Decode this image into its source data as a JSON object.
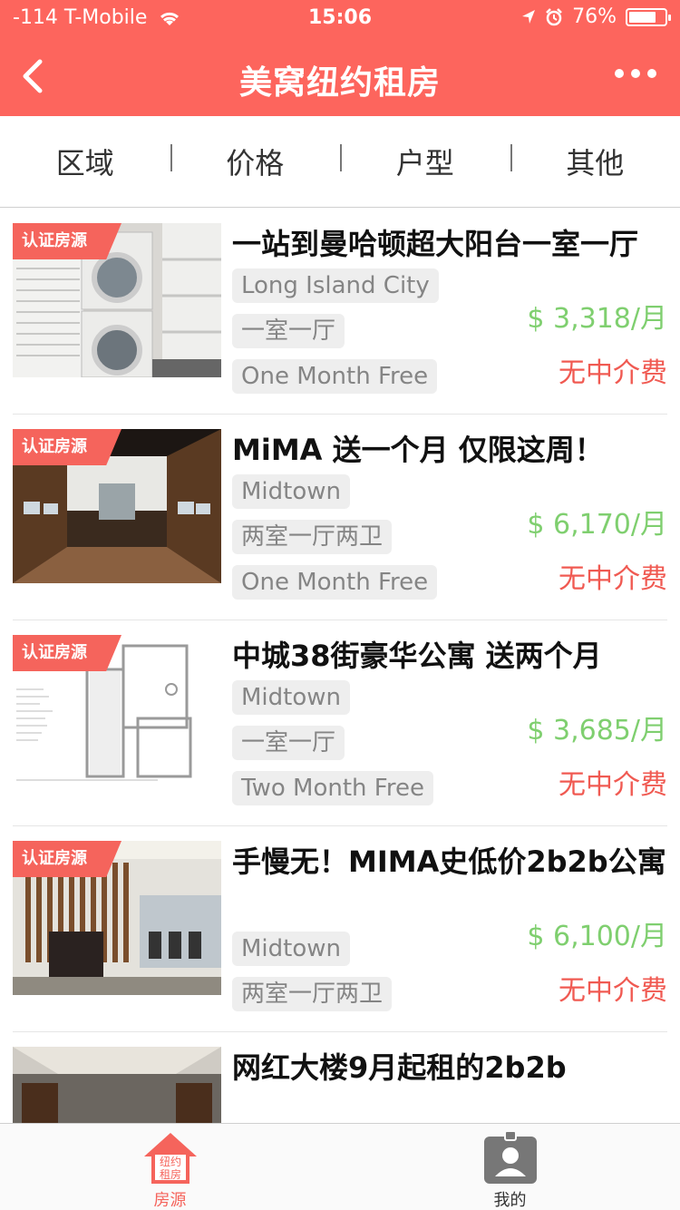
{
  "status_bar": {
    "carrier": "-114 T-Mobile",
    "time": "15:06",
    "battery": "76%"
  },
  "nav": {
    "title": "美窝纽约租房"
  },
  "filters": [
    "区域",
    "价格",
    "户型",
    "其他"
  ],
  "badge_label": "认证房源",
  "listings": [
    {
      "title": "一站到曼哈顿超大阳台一室一厅",
      "tags": [
        "Long Island City",
        "一室一厅",
        "One Month Free"
      ],
      "price": "$ 3,318/月",
      "fee": "无中介费"
    },
    {
      "title": "MiMA 送一个月 仅限这周！",
      "tags": [
        "Midtown",
        "两室一厅两卫",
        "One Month Free"
      ],
      "price": "$ 6,170/月",
      "fee": "无中介费"
    },
    {
      "title": "中城38街豪华公寓 送两个月",
      "tags": [
        "Midtown",
        "一室一厅",
        "Two Month Free"
      ],
      "price": "$ 3,685/月",
      "fee": "无中介费"
    },
    {
      "title": "手慢无！MIMA史低价2b2b公寓",
      "tags": [
        "Midtown",
        "两室一厅两卫"
      ],
      "price": "$ 6,100/月",
      "fee": "无中介费"
    },
    {
      "title": "网红大楼9月起租的2b2b"
    }
  ],
  "tabbar": {
    "home_icon_text": "纽约租房",
    "home_label": "房源",
    "me_label": "我的"
  },
  "colors": {
    "brand": "#fd655d",
    "price": "#7fcf6f",
    "fee": "#f05a52"
  }
}
